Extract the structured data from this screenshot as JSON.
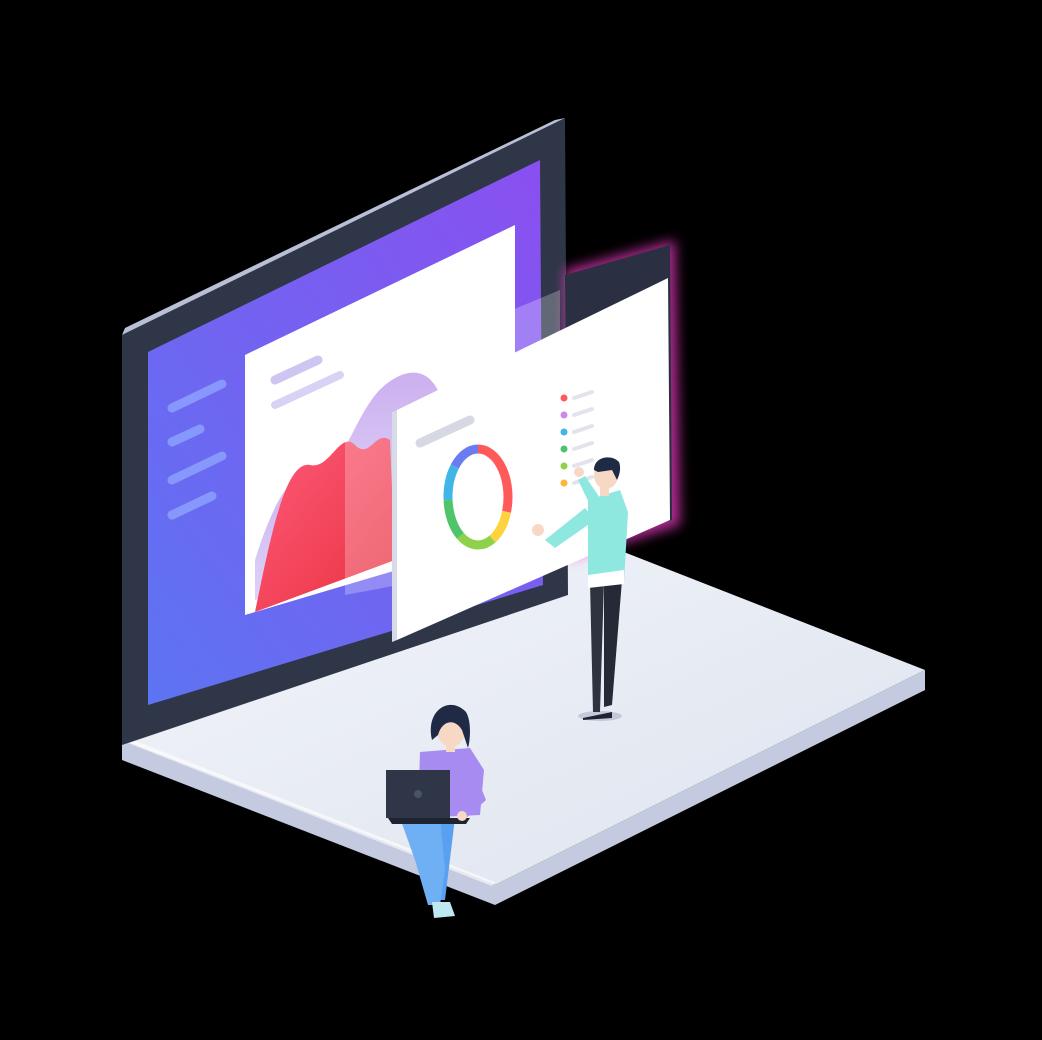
{
  "scene": {
    "background": "#000000",
    "accent_purple": "#7b5cf0",
    "accent_blue": "#5d74f2",
    "platform_color": "#e9edf5",
    "area_chart_colors": [
      "#ff4d6d",
      "#c98be8"
    ],
    "donut_segments": [
      {
        "color": "#ff5a5a",
        "share": 0.3
      },
      {
        "color": "#ffd23f",
        "share": 0.12
      },
      {
        "color": "#8ed14b",
        "share": 0.18
      },
      {
        "color": "#4fc46a",
        "share": 0.14
      },
      {
        "color": "#3fb6e6",
        "share": 0.12
      },
      {
        "color": "#6b7cf3",
        "share": 0.14
      }
    ],
    "legend_dot_colors": [
      "#ff5a5a",
      "#c98be8",
      "#3fb6e6",
      "#4fc46a",
      "#8ed14b",
      "#ffb43f"
    ],
    "figures": [
      {
        "role": "standing man pointing at dashboard",
        "shirt_color": "#8ee8e0",
        "pants_color": "#2f3340"
      },
      {
        "role": "seated woman with laptop",
        "shirt_color": "#a78bf0",
        "pants_color": "#5aa0f0"
      }
    ],
    "icons": [
      "laptop-icon",
      "donut-chart-icon",
      "area-chart-icon"
    ]
  }
}
